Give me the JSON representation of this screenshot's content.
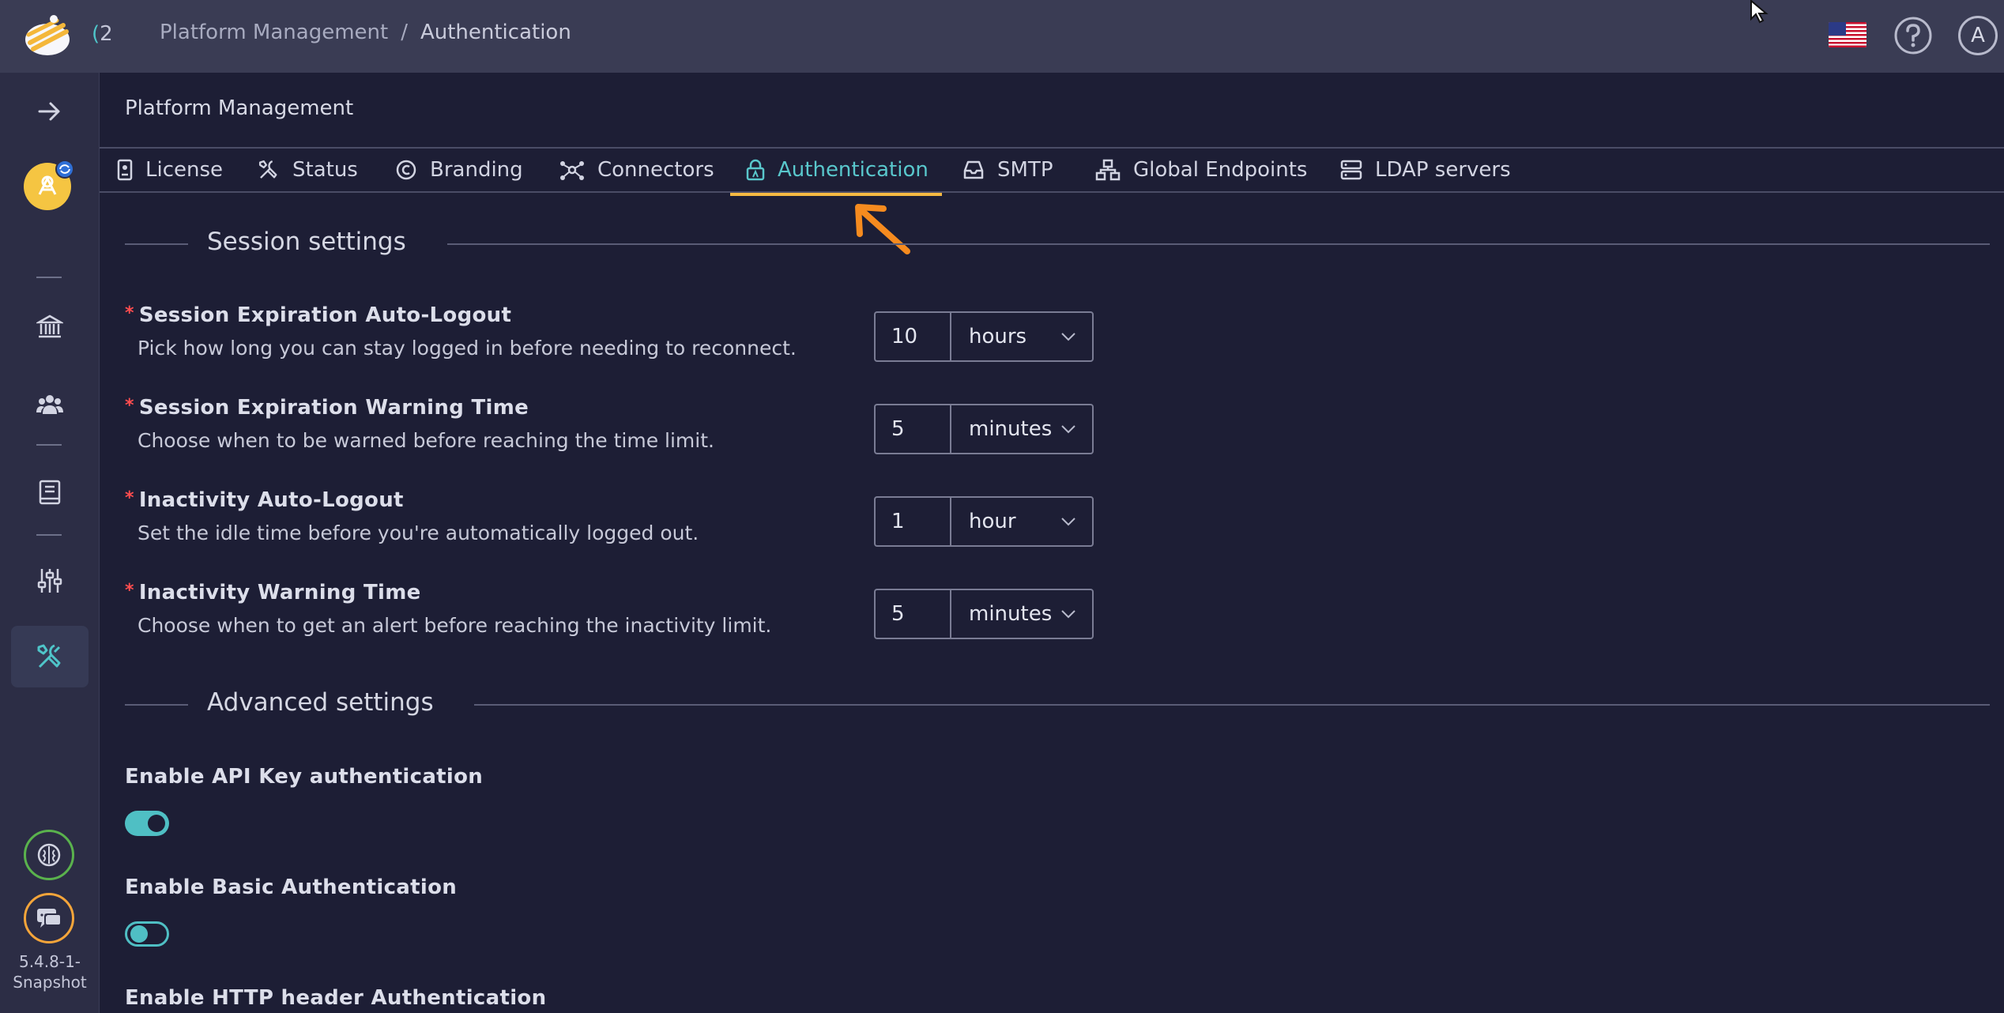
{
  "header": {
    "app_count_paren": "(",
    "app_count": "2",
    "breadcrumb": {
      "parent": "Platform Management",
      "separator": "/",
      "current": "Authentication"
    },
    "avatar_initial": "A",
    "icons": [
      "logo-icon",
      "us-flag-icon",
      "help-icon",
      "user-avatar"
    ]
  },
  "sidebar": {
    "items": [
      {
        "name": "expand-arrow-icon"
      },
      {
        "name": "bank-icon"
      },
      {
        "name": "users-icon"
      },
      {
        "name": "book-icon"
      },
      {
        "name": "sliders-icon"
      },
      {
        "name": "tools-icon",
        "active": true
      }
    ],
    "version": "5.4.8-1-Snapshot",
    "version_line1": "5.4.8-1-",
    "version_line2": "Snapshot"
  },
  "page": {
    "title": "Platform Management",
    "tabs": [
      {
        "label": "License",
        "icon": "id-badge-icon"
      },
      {
        "label": "Status",
        "icon": "tools-icon"
      },
      {
        "label": "Branding",
        "icon": "copyright-icon"
      },
      {
        "label": "Connectors",
        "icon": "connectors-icon"
      },
      {
        "label": "Authentication",
        "icon": "lock-icon",
        "active": true
      },
      {
        "label": "SMTP",
        "icon": "inbox-icon"
      },
      {
        "label": "Global Endpoints",
        "icon": "network-icon"
      },
      {
        "label": "LDAP servers",
        "icon": "server-icon"
      }
    ]
  },
  "session": {
    "heading": "Session settings",
    "settings": [
      {
        "required": "*",
        "title": "Session Expiration Auto-Logout",
        "desc": "Pick how long you can stay logged in before needing to reconnect.",
        "value": "10",
        "unit": "hours"
      },
      {
        "required": "*",
        "title": "Session Expiration Warning Time",
        "desc": "Choose when to be warned before reaching the time limit.",
        "value": "5",
        "unit": "minutes"
      },
      {
        "required": "*",
        "title": "Inactivity Auto-Logout",
        "desc": "Set the idle time before you're automatically logged out.",
        "value": "1",
        "unit": "hour"
      },
      {
        "required": "*",
        "title": "Inactivity Warning Time",
        "desc": "Choose when to get an alert before reaching the inactivity limit.",
        "value": "5",
        "unit": "minutes"
      }
    ]
  },
  "advanced": {
    "heading": "Advanced settings",
    "toggles": [
      {
        "label": "Enable API Key authentication",
        "on": true
      },
      {
        "label": "Enable Basic Authentication",
        "on": false
      },
      {
        "label": "Enable HTTP header Authentication"
      }
    ]
  },
  "colors": {
    "accent": "#4fbfc4",
    "tab_underline": "#f5b942",
    "required": "#ff4d4f",
    "background": "#1d1e35"
  }
}
